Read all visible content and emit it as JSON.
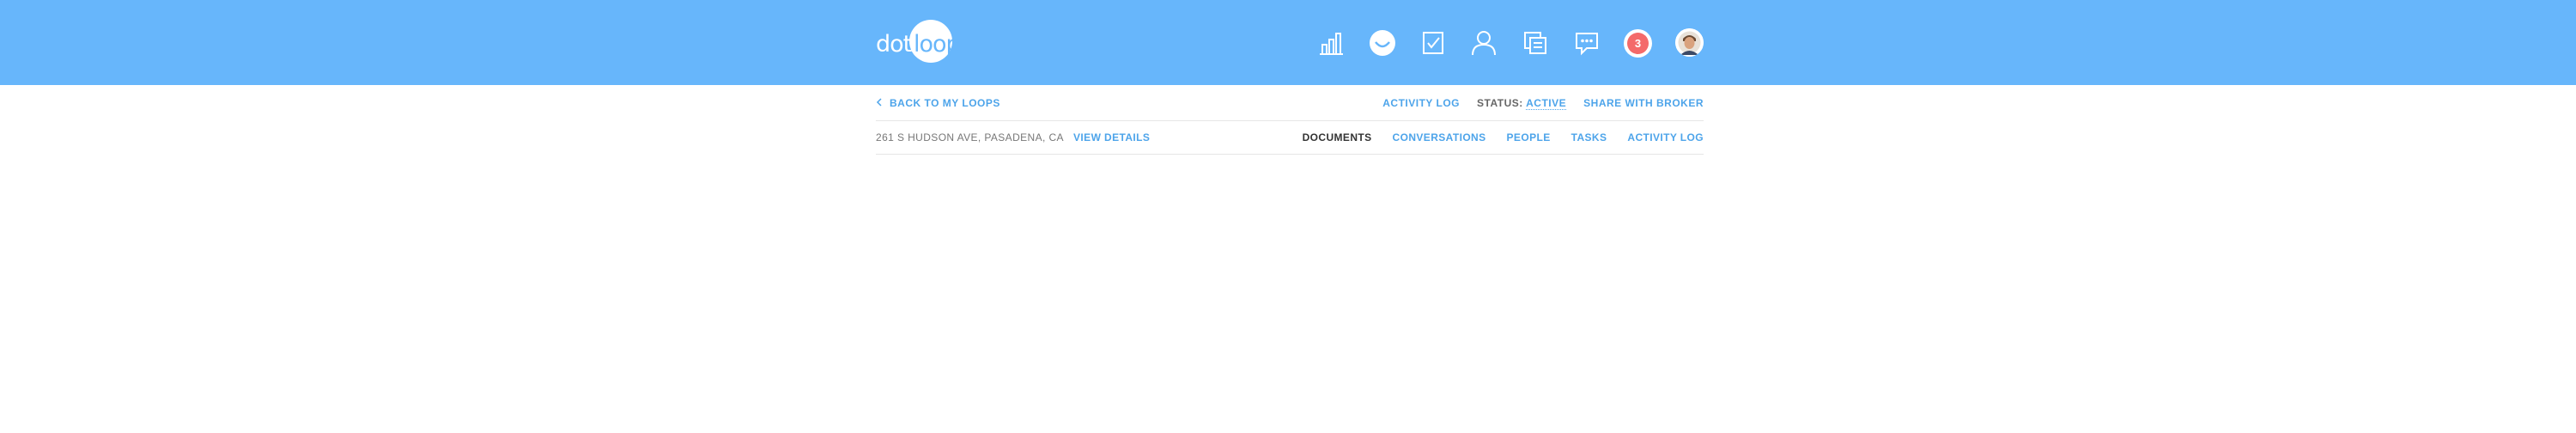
{
  "header": {
    "logo": {
      "left_text": "dot",
      "right_text": "loop"
    },
    "icons": [
      {
        "name": "analytics-icon"
      },
      {
        "name": "loops-icon"
      },
      {
        "name": "tasks-icon"
      },
      {
        "name": "people-icon"
      },
      {
        "name": "templates-icon"
      },
      {
        "name": "messages-icon"
      }
    ],
    "notifications_count": "3"
  },
  "subnav": {
    "back_label": "BACK TO MY LOOPS",
    "activity_log": "ACTIVITY LOG",
    "status_label": "STATUS:",
    "status_value": "ACTIVE",
    "share_label": "SHARE WITH BROKER"
  },
  "loop": {
    "address": "261 S HUDSON AVE, PASADENA, CA",
    "view_details": "VIEW DETAILS"
  },
  "tabs": [
    {
      "label": "DOCUMENTS",
      "active": true
    },
    {
      "label": "CONVERSATIONS",
      "active": false
    },
    {
      "label": "PEOPLE",
      "active": false
    },
    {
      "label": "TASKS",
      "active": false
    },
    {
      "label": "ACTIVITY LOG",
      "active": false
    }
  ],
  "colors": {
    "header_bg": "#67b6fb",
    "accent": "#4da4ea",
    "badge": "#f46a6a"
  }
}
